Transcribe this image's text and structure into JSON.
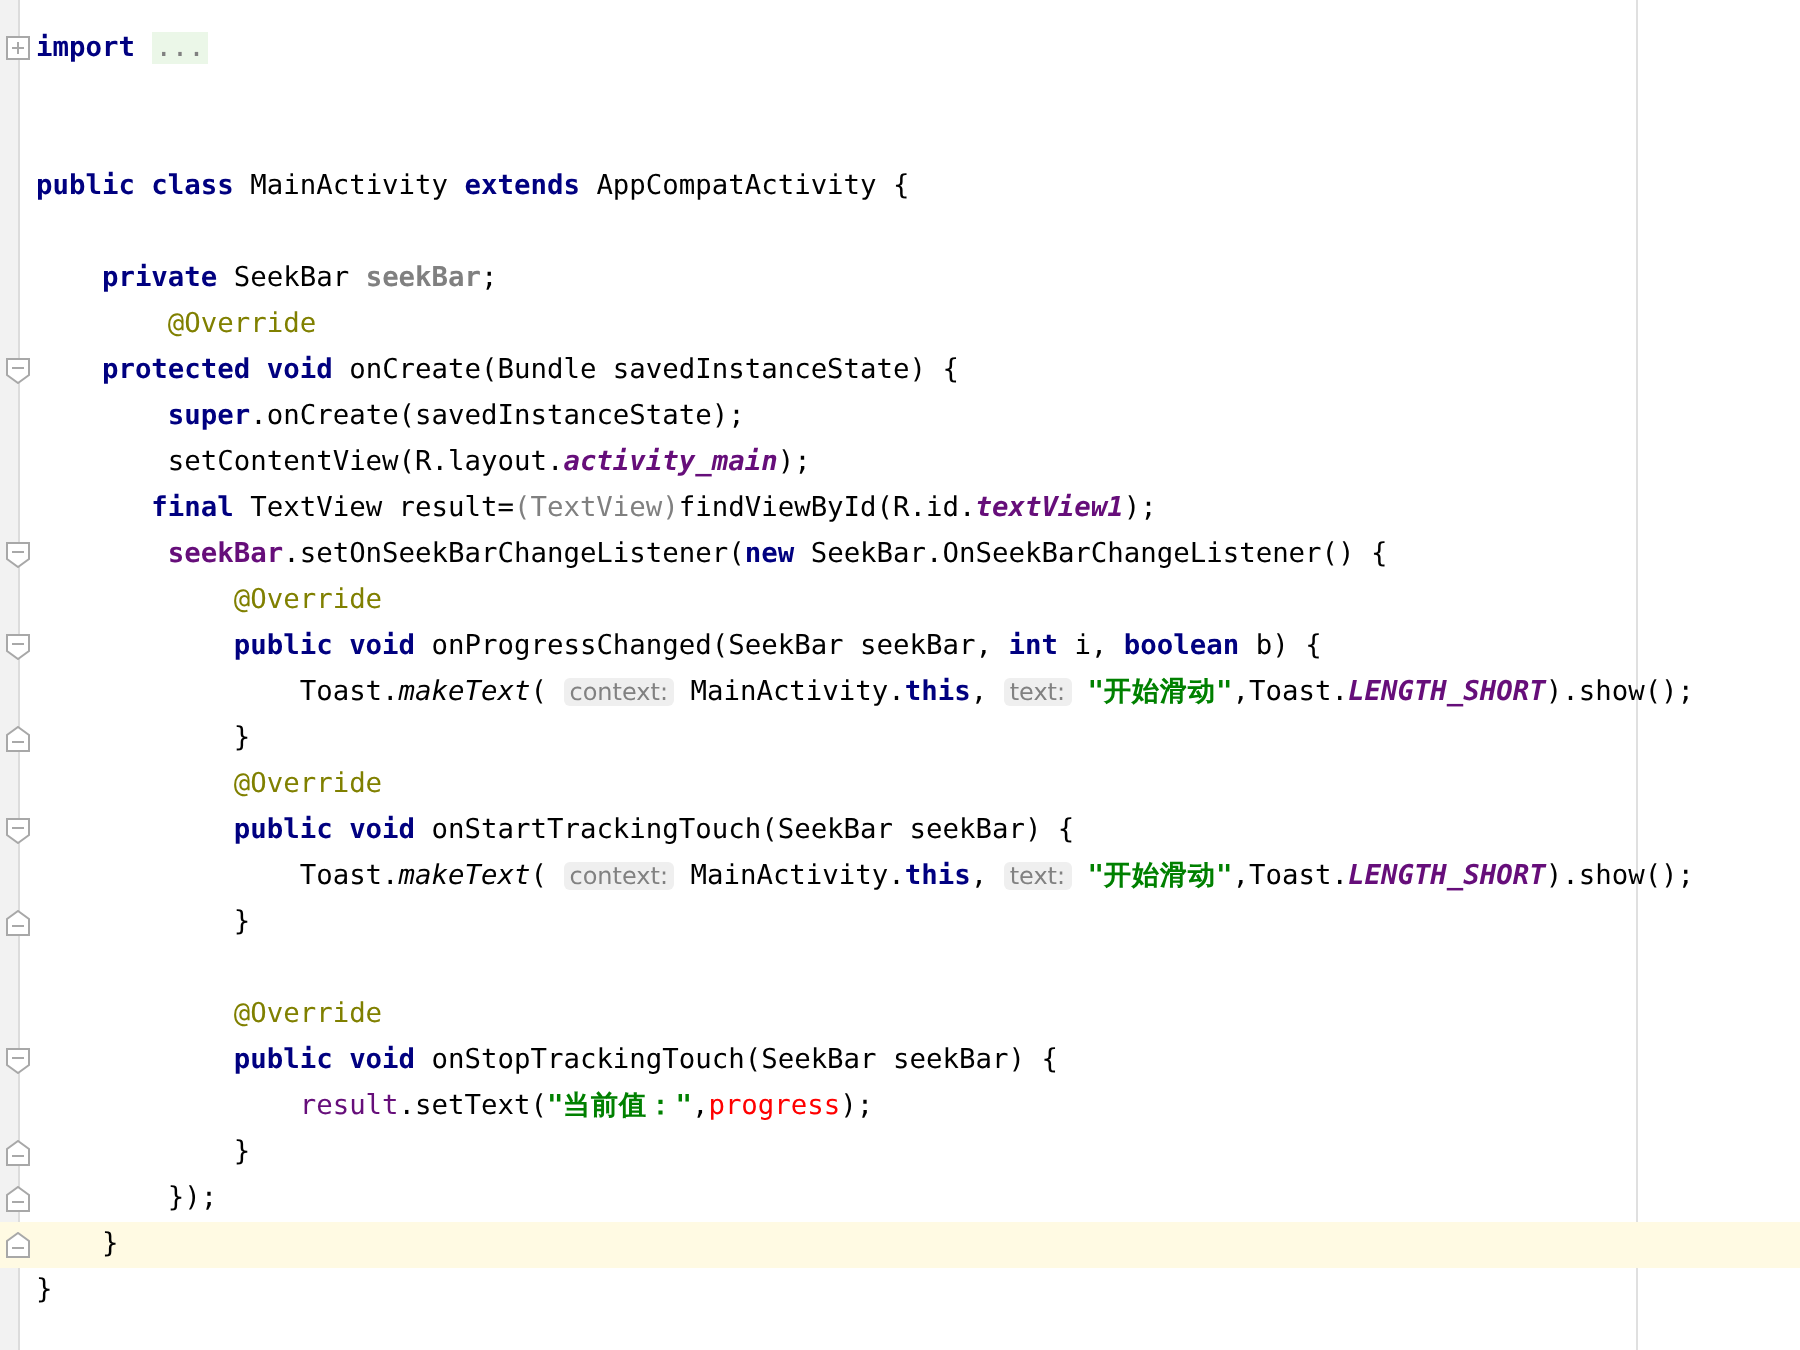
{
  "editor": {
    "lines": [
      {
        "kind": "collapsed",
        "current": false,
        "tokens": [
          {
            "kind": "kw",
            "t": "import "
          },
          {
            "kind": "folded",
            "t": "..."
          }
        ]
      },
      {
        "kind": "plain",
        "current": false
      },
      {
        "kind": "plain",
        "current": false
      },
      {
        "kind": "plain",
        "current": false,
        "tokens": [
          {
            "kind": "kw",
            "t": "public class"
          },
          {
            "kind": "plain",
            "t": " MainActivity "
          },
          {
            "kind": "kw",
            "t": "extends"
          },
          {
            "kind": "plain",
            "t": " AppCompatActivity {"
          }
        ]
      },
      {
        "kind": "plain",
        "current": false
      },
      {
        "kind": "plain",
        "current": false,
        "tokens": [
          {
            "kind": "kw",
            "t": "    private"
          },
          {
            "kind": "plain",
            "t": " SeekBar "
          },
          {
            "kind": "unused",
            "t": "seekBar"
          },
          {
            "kind": "plain",
            "t": ";"
          }
        ]
      },
      {
        "kind": "plain",
        "current": false,
        "tokens": [
          {
            "kind": "ann",
            "t": "        @Override"
          }
        ]
      },
      {
        "kind": "fold_start",
        "current": false,
        "tokens": [
          {
            "kind": "kw",
            "t": "    protected void"
          },
          {
            "kind": "plain",
            "t": " onCreate(Bundle savedInstanceState) {"
          }
        ]
      },
      {
        "kind": "plain",
        "current": false,
        "tokens": [
          {
            "kind": "kw",
            "t": "        super"
          },
          {
            "kind": "plain",
            "t": ".onCreate(savedInstanceState);"
          }
        ]
      },
      {
        "kind": "plain",
        "current": false,
        "tokens": [
          {
            "kind": "plain",
            "t": "        setContentView(R.layout."
          },
          {
            "kind": "static",
            "t": "activity_main"
          },
          {
            "kind": "plain",
            "t": ");"
          }
        ]
      },
      {
        "kind": "plain",
        "current": false,
        "tokens": [
          {
            "kind": "kw",
            "t": "       final"
          },
          {
            "kind": "plain",
            "t": " TextView result="
          },
          {
            "kind": "cast",
            "t": "(TextView)"
          },
          {
            "kind": "plain",
            "t": "findViewById(R.id."
          },
          {
            "kind": "static",
            "t": "textView1"
          },
          {
            "kind": "plain",
            "t": ");"
          }
        ]
      },
      {
        "kind": "fold_start",
        "current": false,
        "tokens": [
          {
            "kind": "field",
            "t": "        seekBar"
          },
          {
            "kind": "plain",
            "t": ".setOnSeekBarChangeListener("
          },
          {
            "kind": "kw",
            "t": "new"
          },
          {
            "kind": "plain",
            "t": " SeekBar.OnSeekBarChangeListener() {"
          }
        ]
      },
      {
        "kind": "plain",
        "current": false,
        "tokens": [
          {
            "kind": "ann",
            "t": "            @Override"
          }
        ]
      },
      {
        "kind": "fold_start",
        "current": false,
        "tokens": [
          {
            "kind": "kw",
            "t": "            public void"
          },
          {
            "kind": "plain",
            "t": " onProgressChanged(SeekBar seekBar, "
          },
          {
            "kind": "kw",
            "t": "int"
          },
          {
            "kind": "plain",
            "t": " i, "
          },
          {
            "kind": "kw",
            "t": "boolean"
          },
          {
            "kind": "plain",
            "t": " b) {"
          }
        ]
      },
      {
        "kind": "plain",
        "current": false,
        "tokens": [
          {
            "kind": "plain",
            "t": "                Toast."
          },
          {
            "kind": "method",
            "t": "makeText"
          },
          {
            "kind": "plain",
            "t": "( "
          },
          {
            "kind": "hint",
            "t": "context:"
          },
          {
            "kind": "plain",
            "t": " MainActivity."
          },
          {
            "kind": "kw",
            "t": "this"
          },
          {
            "kind": "plain",
            "t": ", "
          },
          {
            "kind": "hint",
            "t": "text:"
          },
          {
            "kind": "str",
            "t": " \"开始滑动\""
          },
          {
            "kind": "plain",
            "t": ",Toast."
          },
          {
            "kind": "static",
            "t": "LENGTH_SHORT"
          },
          {
            "kind": "plain",
            "t": ").show();"
          }
        ]
      },
      {
        "kind": "fold_end",
        "current": false,
        "tokens": [
          {
            "kind": "plain",
            "t": "            }"
          }
        ]
      },
      {
        "kind": "plain",
        "current": false,
        "tokens": [
          {
            "kind": "ann",
            "t": "            @Override"
          }
        ]
      },
      {
        "kind": "fold_start",
        "current": false,
        "tokens": [
          {
            "kind": "kw",
            "t": "            public void"
          },
          {
            "kind": "plain",
            "t": " onStartTrackingTouch(SeekBar seekBar) {"
          }
        ]
      },
      {
        "kind": "plain",
        "current": false,
        "tokens": [
          {
            "kind": "plain",
            "t": "                Toast."
          },
          {
            "kind": "method",
            "t": "makeText"
          },
          {
            "kind": "plain",
            "t": "( "
          },
          {
            "kind": "hint",
            "t": "context:"
          },
          {
            "kind": "plain",
            "t": " MainActivity."
          },
          {
            "kind": "kw",
            "t": "this"
          },
          {
            "kind": "plain",
            "t": ", "
          },
          {
            "kind": "hint",
            "t": "text:"
          },
          {
            "kind": "str",
            "t": " \"开始滑动\""
          },
          {
            "kind": "plain",
            "t": ",Toast."
          },
          {
            "kind": "static",
            "t": "LENGTH_SHORT"
          },
          {
            "kind": "plain",
            "t": ").show();"
          }
        ]
      },
      {
        "kind": "fold_end",
        "current": false,
        "tokens": [
          {
            "kind": "plain",
            "t": "            }"
          }
        ]
      },
      {
        "kind": "plain",
        "current": false
      },
      {
        "kind": "plain",
        "current": false,
        "tokens": [
          {
            "kind": "ann",
            "t": "            @Override"
          }
        ]
      },
      {
        "kind": "fold_start",
        "current": false,
        "tokens": [
          {
            "kind": "kw",
            "t": "            public void"
          },
          {
            "kind": "plain",
            "t": " onStopTrackingTouch(SeekBar seekBar) {"
          }
        ]
      },
      {
        "kind": "plain",
        "current": false,
        "tokens": [
          {
            "kind": "local",
            "t": "                result"
          },
          {
            "kind": "plain",
            "t": ".setText("
          },
          {
            "kind": "str",
            "t": "\"当前值：\""
          },
          {
            "kind": "plain",
            "t": ","
          },
          {
            "kind": "error",
            "t": "progress"
          },
          {
            "kind": "plain",
            "t": ");"
          }
        ]
      },
      {
        "kind": "fold_end",
        "current": false,
        "tokens": [
          {
            "kind": "plain",
            "t": "            }"
          }
        ]
      },
      {
        "kind": "fold_end",
        "current": false,
        "tokens": [
          {
            "kind": "plain",
            "t": "        });"
          }
        ]
      },
      {
        "kind": "fold_end",
        "current": true,
        "tokens": [
          {
            "kind": "plain",
            "t": "    }"
          }
        ]
      },
      {
        "kind": "plain",
        "current": false,
        "tokens": [
          {
            "kind": "plain",
            "t": "}"
          }
        ]
      }
    ]
  }
}
